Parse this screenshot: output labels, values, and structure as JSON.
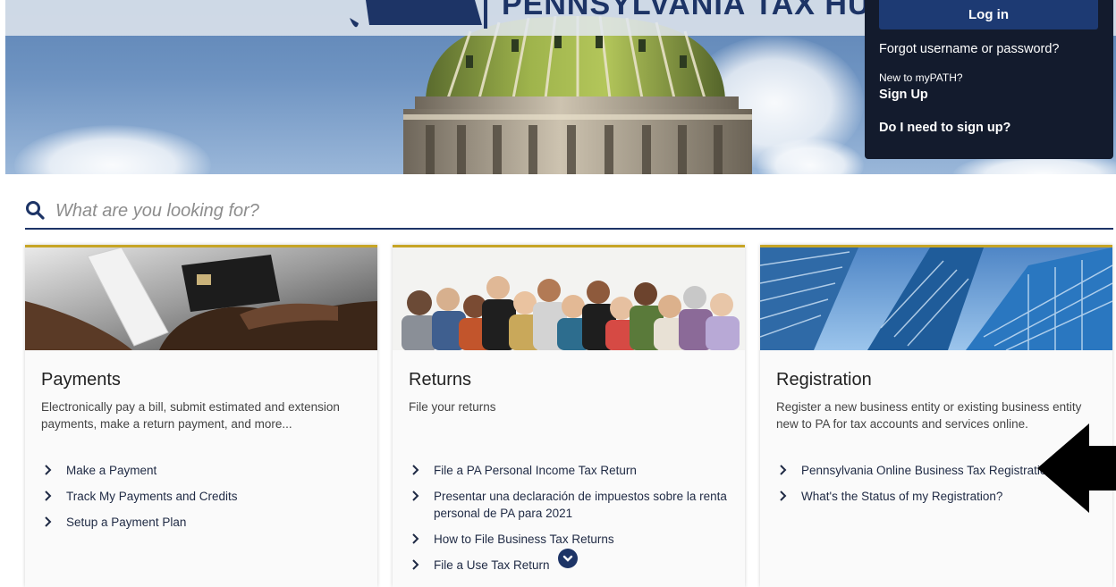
{
  "header": {
    "title": "PENNSYLVANIA TAX HUB"
  },
  "login": {
    "login_label": "Log in",
    "forgot_label": "Forgot username or password?",
    "new_label": "New to myPATH?",
    "signup_label": "Sign Up",
    "need_signup_label": "Do I need to sign up?"
  },
  "search": {
    "placeholder": "What are you looking for?"
  },
  "cards": [
    {
      "title": "Payments",
      "description": "Electronically pay a bill, submit estimated and extension payments, make a return payment, and more...",
      "links": [
        "Make a Payment",
        "Track My Payments and Credits",
        "Setup a Payment Plan"
      ]
    },
    {
      "title": "Returns",
      "description": "File your returns",
      "links": [
        "File a PA Personal Income Tax Return",
        "Presentar una declaración de impuestos sobre la renta personal de PA para 2021",
        "How to File Business Tax Returns",
        "File a Use Tax Return"
      ]
    },
    {
      "title": "Registration",
      "description": "Register a new business entity or existing business entity new to PA for tax accounts and services online.",
      "links": [
        "Pennsylvania Online Business Tax Registration",
        "What's the Status of my Registration?"
      ]
    }
  ],
  "colors": {
    "navy": "#1d3466",
    "panel": "#131b2d",
    "gold": "#c7a526"
  }
}
